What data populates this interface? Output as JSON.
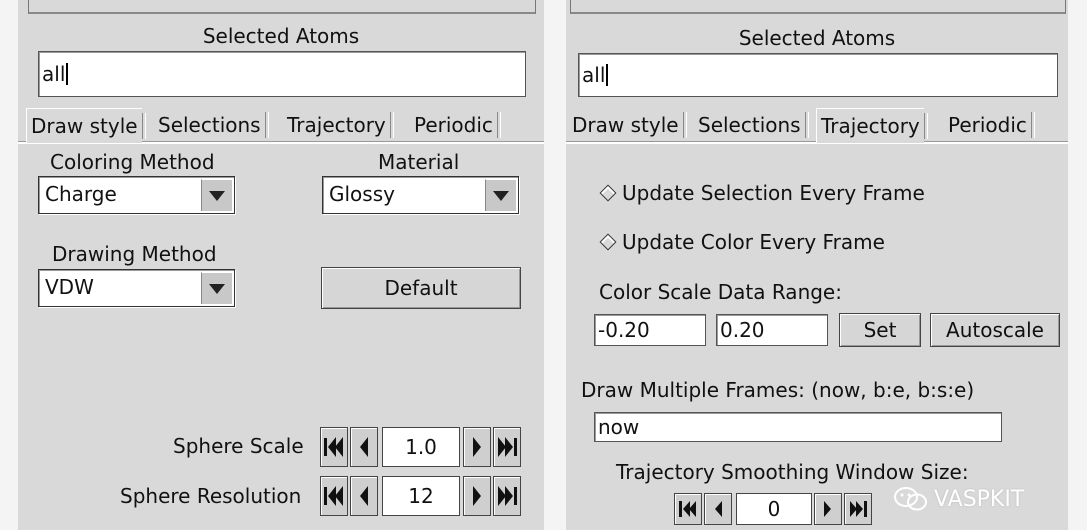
{
  "left": {
    "selected_atoms_label": "Selected Atoms",
    "selection_value": "all",
    "tabs": [
      "Draw style",
      "Selections",
      "Trajectory",
      "Periodic"
    ],
    "active_tab": "Draw style",
    "coloring_method_label": "Coloring Method",
    "coloring_method_value": "Charge",
    "material_label": "Material",
    "material_value": "Glossy",
    "drawing_method_label": "Drawing Method",
    "drawing_method_value": "VDW",
    "default_button": "Default",
    "sphere_scale_label": "Sphere Scale",
    "sphere_scale_value": "1.0",
    "sphere_resolution_label": "Sphere Resolution",
    "sphere_resolution_value": "12"
  },
  "right": {
    "selected_atoms_label": "Selected Atoms",
    "selection_value": "all",
    "tabs": [
      "Draw style",
      "Selections",
      "Trajectory",
      "Periodic"
    ],
    "active_tab": "Trajectory",
    "update_selection_label": "Update Selection Every Frame",
    "update_color_label": "Update Color Every Frame",
    "color_scale_label": "Color Scale Data Range:",
    "range_min": "-0.20",
    "range_max": "0.20",
    "set_button": "Set",
    "autoscale_button": "Autoscale",
    "multiple_frames_label": "Draw Multiple Frames: (now, b:e, b:s:e)",
    "multiple_frames_value": "now",
    "smoothing_label": "Trajectory Smoothing Window Size:",
    "smoothing_value": "0"
  },
  "watermark": "VASPKIT"
}
